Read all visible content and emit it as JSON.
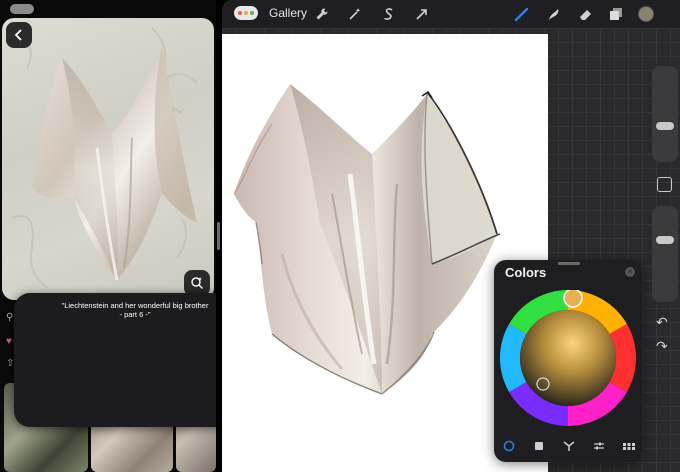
{
  "left": {
    "popup_text": "\"Liechtenstein and her wonderful big brother\n- part 6 -\""
  },
  "toolbar": {
    "gallery_label": "Gallery",
    "actions_icon": "wrench-icon",
    "adjustments_icon": "magic-wand-icon",
    "selection_icon": "selection-s-icon",
    "transform_icon": "arrow-cursor-icon",
    "brush_color": "#2f7fe0",
    "current_color": "#8a8270"
  },
  "colors_panel": {
    "title": "Colors",
    "tabs": [
      "disc",
      "classic",
      "harmony",
      "value",
      "palettes"
    ],
    "active_tab": "disc"
  }
}
